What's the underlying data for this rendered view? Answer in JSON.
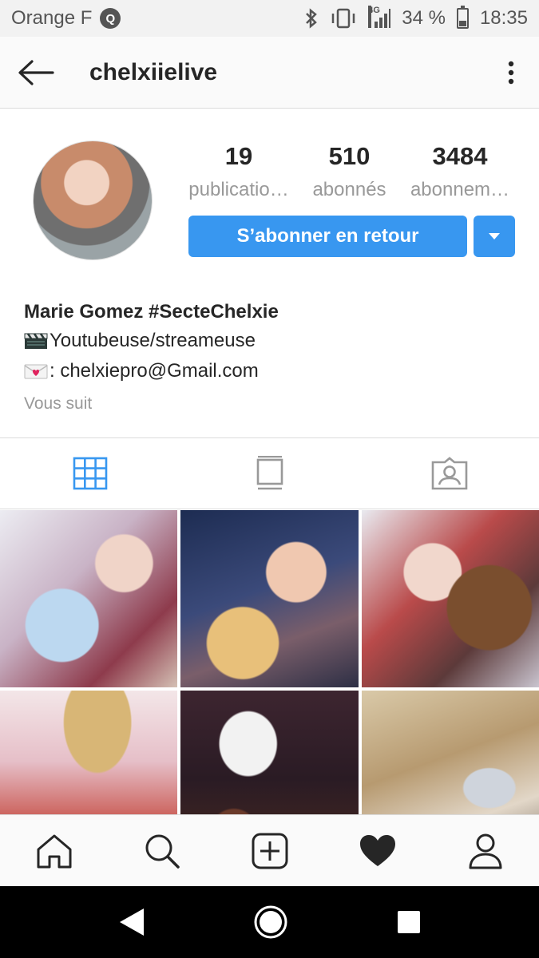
{
  "status_bar": {
    "carrier": "Orange F",
    "network": "4G",
    "battery": "34 %",
    "battery_level": 0.34,
    "time": "18:35"
  },
  "app_bar": {
    "username": "chelxiielive",
    "back_icon": "arrow-left-icon",
    "more_icon": "more-vertical-icon"
  },
  "profile": {
    "stats": [
      {
        "value": "19",
        "label": "publicatio…"
      },
      {
        "value": "510",
        "label": "abonnés"
      },
      {
        "value": "3484",
        "label": "abonnem…"
      }
    ],
    "follow_back_label": "S’abonner en retour",
    "name": "Marie Gomez #SecteChelxie",
    "bio_lines": [
      "Youtubeuse/streameuse",
      ": chelxiepro@Gmail.com"
    ],
    "follows_you": "Vous suit"
  },
  "tabs": [
    {
      "icon": "grid-icon",
      "active": true
    },
    {
      "icon": "feed-icon",
      "active": false
    },
    {
      "icon": "tagged-icon",
      "active": false
    }
  ],
  "colors": {
    "accent": "#3897f0",
    "text": "#262626",
    "muted": "#999999"
  },
  "bottom_nav": [
    "home-icon",
    "search-icon",
    "add-icon",
    "heart-icon",
    "profile-icon"
  ]
}
